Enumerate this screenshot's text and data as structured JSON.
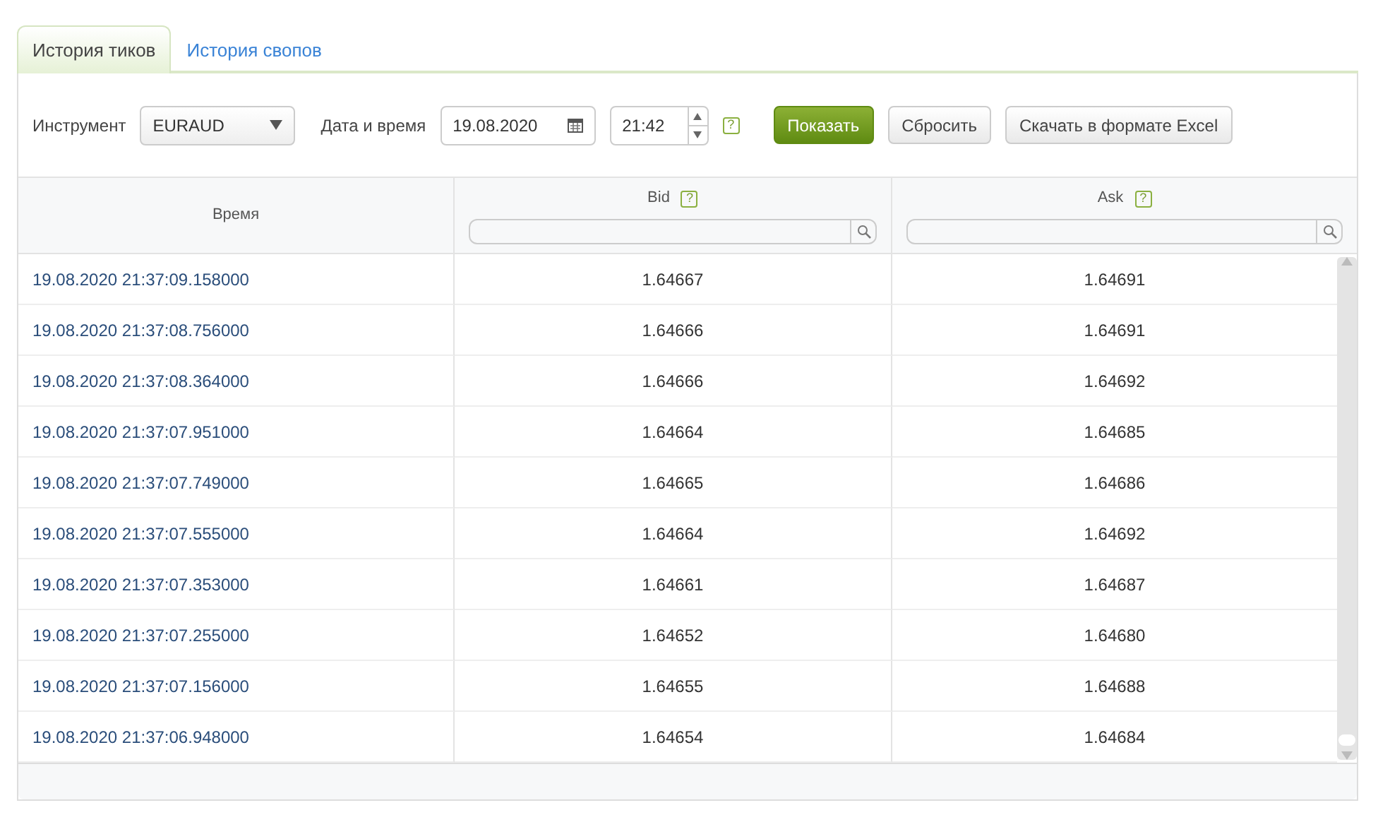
{
  "tabs": [
    {
      "label": "История тиков",
      "selected": true
    },
    {
      "label": "История свопов",
      "selected": false
    }
  ],
  "filters": {
    "instrument_label": "Инструмент",
    "instrument": "EURAUD",
    "datetime_label": "Дата и время",
    "date": "19.08.2020",
    "time": "21:42",
    "help": "?",
    "buttons": [
      {
        "label": "Показать",
        "kind": "primary"
      },
      {
        "label": "Сбросить",
        "kind": "secondary"
      },
      {
        "label": "Скачать в формате Excel",
        "kind": "secondary"
      }
    ]
  },
  "table": {
    "columns": [
      {
        "label": "Время",
        "kind": "plain"
      },
      {
        "label": "Bid",
        "kind": "search",
        "help": "?"
      },
      {
        "label": "Ask",
        "kind": "search",
        "help": "?"
      }
    ],
    "rows": [
      [
        "19.08.2020 21:37:09.158000",
        "1.64667",
        "1.64691"
      ],
      [
        "19.08.2020 21:37:08.756000",
        "1.64666",
        "1.64691"
      ],
      [
        "19.08.2020 21:37:08.364000",
        "1.64666",
        "1.64692"
      ],
      [
        "19.08.2020 21:37:07.951000",
        "1.64664",
        "1.64685"
      ],
      [
        "19.08.2020 21:37:07.749000",
        "1.64665",
        "1.64686"
      ],
      [
        "19.08.2020 21:37:07.555000",
        "1.64664",
        "1.64692"
      ],
      [
        "19.08.2020 21:37:07.353000",
        "1.64661",
        "1.64687"
      ],
      [
        "19.08.2020 21:37:07.255000",
        "1.64652",
        "1.64680"
      ],
      [
        "19.08.2020 21:37:07.156000",
        "1.64655",
        "1.64688"
      ],
      [
        "19.08.2020 21:37:06.948000",
        "1.64654",
        "1.64684"
      ]
    ]
  }
}
